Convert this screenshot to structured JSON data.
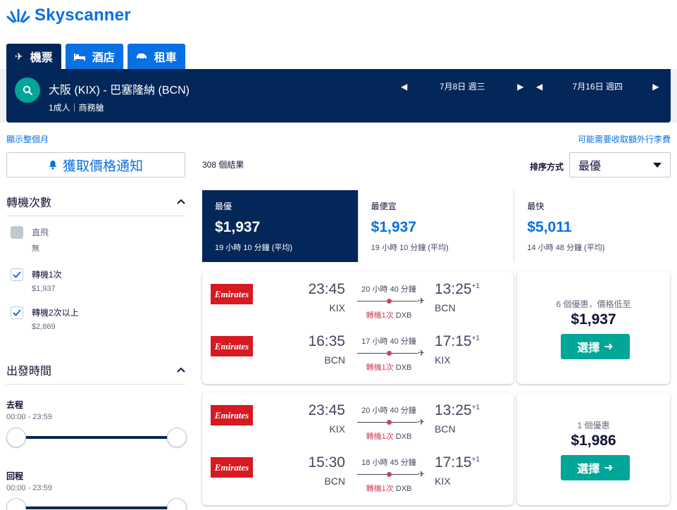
{
  "brand": {
    "name": "Skyscanner"
  },
  "tabs": [
    {
      "label": "機票",
      "icon": "plane-icon"
    },
    {
      "label": "酒店",
      "icon": "bed-icon"
    },
    {
      "label": "租車",
      "icon": "car-icon"
    }
  ],
  "search": {
    "route": "大阪 (KIX) - 巴塞隆納 (BCN)",
    "passengers": "1成人｜商務艙",
    "depart_date": "7月8日 週三",
    "return_date": "7月16日 週四"
  },
  "links": {
    "show_month": "顯示整個月",
    "baggage_fees": "可能需要收取額外行李費"
  },
  "sidebar": {
    "price_alert": "獲取價格通知",
    "stops_title": "轉機次數",
    "stops": [
      {
        "label": "直飛",
        "sub": "無",
        "checked": false,
        "disabled": true
      },
      {
        "label": "轉機1次",
        "sub": "$1,937",
        "checked": true,
        "disabled": false
      },
      {
        "label": "轉機2次以上",
        "sub": "$2,869",
        "checked": true,
        "disabled": false
      }
    ],
    "times_title": "出發時間",
    "outbound_label": "去程",
    "outbound_range": "00:00 - 23:59",
    "return_label": "回程",
    "return_range": "00:00 - 23:59"
  },
  "results": {
    "count": "308 個結果",
    "sort_label": "排序方式",
    "sort_value": "最優"
  },
  "summary": [
    {
      "title": "最優",
      "price": "$1,937",
      "duration": "19 小時 10 分鐘 (平均)"
    },
    {
      "title": "最便宜",
      "price": "$1,937",
      "duration": "19 小時 10 分鐘 (平均)"
    },
    {
      "title": "最快",
      "price": "$5,011",
      "duration": "14 小時 48 分鐘 (平均)"
    }
  ],
  "itineraries": [
    {
      "legs": [
        {
          "airline": "Emirates",
          "dep_time": "23:45",
          "dep_code": "KIX",
          "duration": "20 小時 40 分鐘",
          "stops": "轉機1次",
          "via": "DXB",
          "arr_time": "13:25",
          "arr_offset": "+1",
          "arr_code": "BCN"
        },
        {
          "airline": "Emirates",
          "dep_time": "16:35",
          "dep_code": "BCN",
          "duration": "17 小時 40 分鐘",
          "stops": "轉機1次",
          "via": "DXB",
          "arr_time": "17:15",
          "arr_offset": "+1",
          "arr_code": "KIX"
        }
      ],
      "deals": "6 個優惠，價格低至",
      "price": "$1,937",
      "select": "選擇"
    },
    {
      "legs": [
        {
          "airline": "Emirates",
          "dep_time": "23:45",
          "dep_code": "KIX",
          "duration": "20 小時 40 分鐘",
          "stops": "轉機1次",
          "via": "DXB",
          "arr_time": "13:25",
          "arr_offset": "+1",
          "arr_code": "BCN"
        },
        {
          "airline": "Emirates",
          "dep_time": "15:30",
          "dep_code": "BCN",
          "duration": "18 小時 45 分鐘",
          "stops": "轉機1次",
          "via": "DXB",
          "arr_time": "17:15",
          "arr_offset": "+1",
          "arr_code": "KIX"
        }
      ],
      "deals": "1 個優惠",
      "price": "$1,986",
      "select": "選擇"
    }
  ],
  "colors": {
    "brand_blue": "#0770e3",
    "navy": "#042759",
    "teal": "#00a698",
    "emirates_red": "#d71921",
    "stop_red": "#d1435b"
  }
}
